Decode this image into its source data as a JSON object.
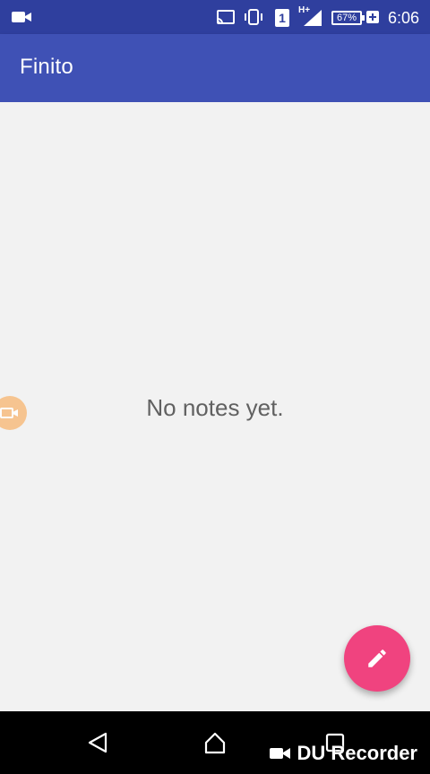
{
  "status_bar": {
    "time": "6:06",
    "battery": "67%",
    "sim_slot": "1",
    "network": "H+",
    "icons": [
      "video-recording-icon",
      "cast-icon",
      "vibrate-icon",
      "sim-icon",
      "signal-icon",
      "battery-charging-icon"
    ]
  },
  "app_bar": {
    "title": "Finito"
  },
  "main": {
    "empty_message": "No notes yet."
  },
  "fab": {
    "icon": "edit-pencil-icon",
    "color": "#f0437f"
  },
  "overlay": {
    "recorder_watermark": "DU Recorder",
    "recorder_bubble_icon": "camera-icon"
  },
  "nav_bar": {
    "buttons": [
      "back-icon",
      "home-icon",
      "recents-icon"
    ]
  },
  "colors": {
    "primary": "#3f51b5",
    "primary_dark": "#2f3f9e",
    "accent": "#f0437f",
    "background": "#f2f2f2"
  }
}
